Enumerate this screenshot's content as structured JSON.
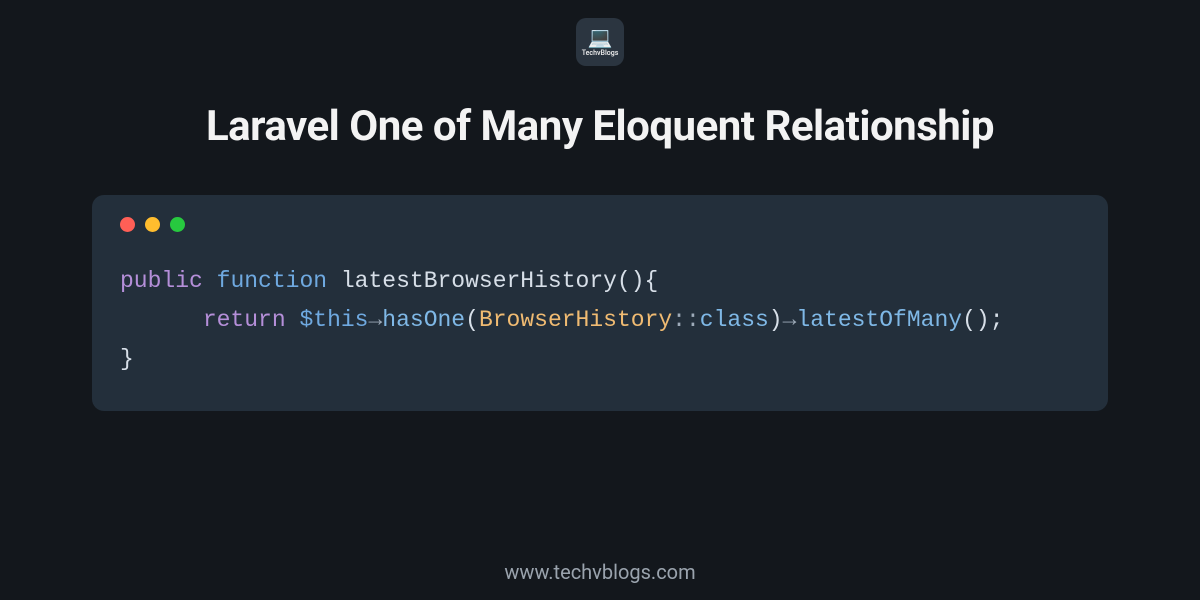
{
  "logo": {
    "text": "TechvBlogs",
    "iconName": "laptop-icon"
  },
  "title": "Laravel One of Many Eloquent Relationship",
  "code": {
    "line1": {
      "keyword1": "public",
      "keyword2": "function",
      "funcName": "latestBrowserHistory",
      "openParen": "(",
      "closeParen": ")",
      "openBrace": "{"
    },
    "line2": {
      "indent": "      ",
      "return": "return",
      "thisVar": "$this",
      "arrow1": "→",
      "hasOne": "hasOne",
      "openParen": "(",
      "className": "BrowserHistory",
      "scope": "::",
      "classKw": "class",
      "closeParen": ")",
      "arrow2": "→",
      "latestOfMany": "latestOfMany",
      "openParen2": "(",
      "closeParen2": ")",
      "semi": ";"
    },
    "line3": {
      "closeBrace": "}"
    }
  },
  "footer": {
    "url": "www.techvblogs.com"
  }
}
